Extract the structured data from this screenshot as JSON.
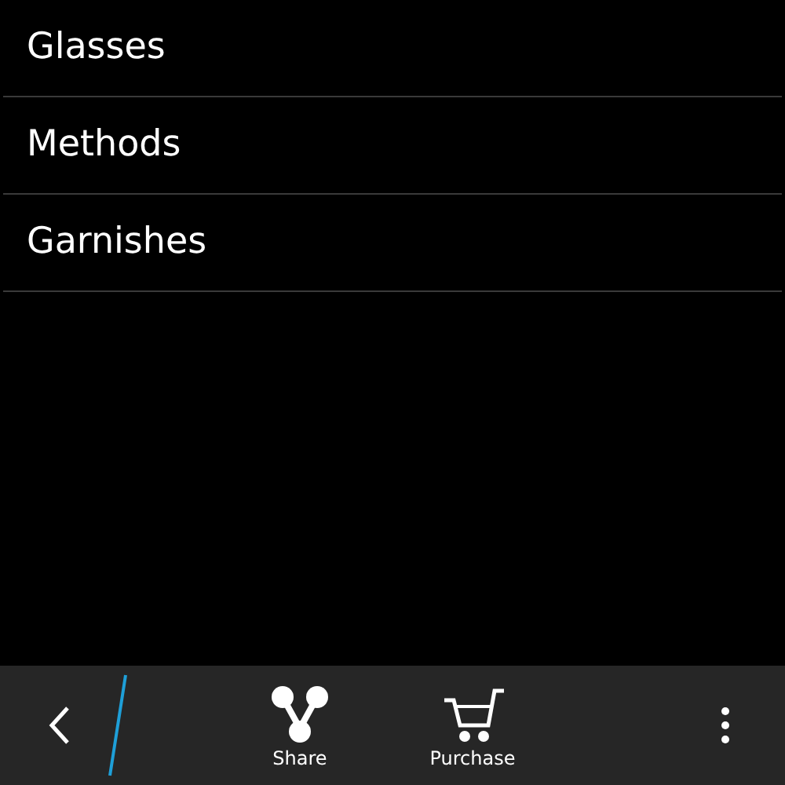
{
  "list": [
    {
      "label": "Glasses"
    },
    {
      "label": "Methods"
    },
    {
      "label": "Garnishes"
    }
  ],
  "action_bar": {
    "actions": [
      {
        "label": "Share",
        "kind": "share"
      },
      {
        "label": "Purchase",
        "kind": "cart"
      }
    ]
  }
}
